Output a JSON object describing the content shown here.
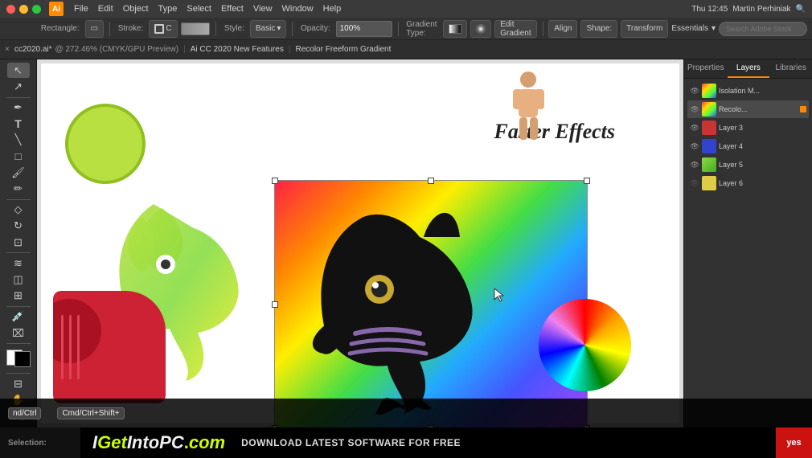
{
  "menubar": {
    "logo_text": "Ai",
    "items": [
      "File",
      "Edit",
      "Object",
      "Type",
      "Select",
      "Effect",
      "View",
      "Window",
      "Help"
    ],
    "time": "Thu 12:45",
    "user": "Martin Perhiniak",
    "workspace": "Essentials"
  },
  "toolbar": {
    "shape_label": "Rectangle:",
    "stroke_label": "Stroke:",
    "fill_label": "C",
    "style_label": "Style:",
    "basic_label": "Basic",
    "opacity_label": "Opacity:",
    "opacity_value": "100%",
    "gradient_type_label": "Gradient Type:",
    "edit_gradient_label": "Edit Gradient",
    "align_label": "Align",
    "shape_dropdown": "Shape:",
    "transform_label": "Transform"
  },
  "secondary_toolbar": {
    "close_icon": "×",
    "doc_name": "cc2020.ai*",
    "doc_info": "@ 272.46% (CMYK/GPU Preview)",
    "separator": "|",
    "feature_1": "Ai CC 2020 New Features",
    "feature_2": "Recolor Freeform Gradient"
  },
  "canvas": {
    "faster_effects_text": "Faster Effects"
  },
  "layers_panel": {
    "tabs": [
      "Properties",
      "Layers",
      "Libraries"
    ],
    "active_tab": "Layers",
    "items": [
      {
        "name": "Isolation M...",
        "visible": true,
        "active": false,
        "thumb": "gradient"
      },
      {
        "name": "Recolo...",
        "visible": true,
        "active": true,
        "thumb": "gradient"
      },
      {
        "name": "Layer 3",
        "visible": true,
        "active": false,
        "thumb": "red"
      },
      {
        "name": "Layer 4",
        "visible": true,
        "active": false,
        "thumb": "blue"
      },
      {
        "name": "Layer 5",
        "visible": true,
        "active": false,
        "thumb": "green"
      },
      {
        "name": "Layer 6",
        "visible": false,
        "active": false,
        "thumb": "yellow"
      }
    ]
  },
  "keyboard_shortcuts": {
    "item1": {
      "key": "nd/Ctrl",
      "desc": ""
    },
    "item2": {
      "key": "Cmd/Ctrl+Shift+",
      "desc": ""
    }
  },
  "bottom_bar": {
    "section1": "",
    "logo_text": "IGetIntoPC.com",
    "tagline": "Download Latest Software for Free",
    "yes_button": "yes"
  },
  "status_bar": {
    "left_label": "Selection:",
    "right_label": ""
  }
}
